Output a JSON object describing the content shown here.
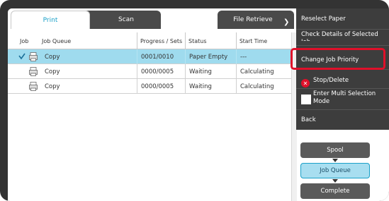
{
  "tabs": {
    "print": "Print",
    "scan": "Scan",
    "file_retrieve": "File Retrieve"
  },
  "table": {
    "headers": {
      "job": "Job",
      "job_queue": "Job Queue",
      "progress": "Progress / Sets",
      "status": "Status",
      "start_time": "Start Time"
    },
    "rows": [
      {
        "name": "Copy",
        "progress": "0001/0010",
        "status": "Paper Empty",
        "start": "---",
        "selected": true
      },
      {
        "name": "Copy",
        "progress": "0000/0005",
        "status": "Waiting",
        "start": "Calculating",
        "selected": false
      },
      {
        "name": "Copy",
        "progress": "0000/0005",
        "status": "Waiting",
        "start": "Calculating",
        "selected": false
      }
    ]
  },
  "menu": {
    "reselect_paper": "Reselect Paper",
    "check_details": "Check Details of Selected Job",
    "change_priority": "Change Job Priority",
    "stop_delete": "Stop/Delete",
    "multi_select": "Enter Multi Selection Mode",
    "back": "Back"
  },
  "side": {
    "spool": "Spool",
    "job_queue": "Job Queue",
    "complete": "Complete"
  },
  "colors": {
    "selected_row": "#9fdbee",
    "accent": "#1aa0c8",
    "highlight": "#e0102a",
    "menu_bg": "#3d3d3d"
  }
}
